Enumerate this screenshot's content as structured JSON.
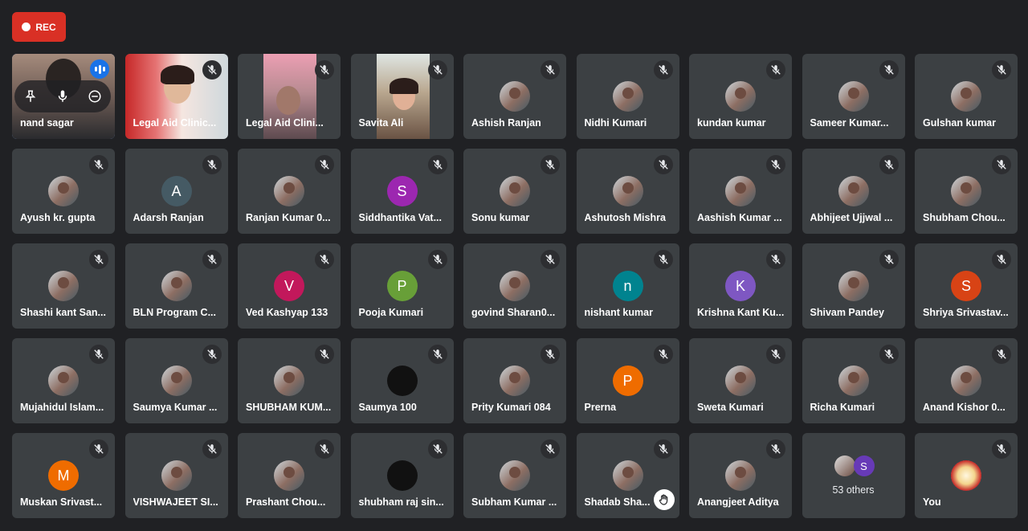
{
  "recording": {
    "label": "REC",
    "color": "#d93025"
  },
  "colors": {
    "tile": "#3c4043",
    "background": "#202124",
    "active_outline": "#8ab4f8"
  },
  "participants": [
    {
      "name": "nand sagar",
      "type": "video",
      "active_speaker": true
    },
    {
      "name": "Legal Aid Clinic...",
      "type": "video"
    },
    {
      "name": "Legal Aid Clini...",
      "type": "video"
    },
    {
      "name": "Savita Ali",
      "type": "video"
    },
    {
      "name": "Ashish Ranjan",
      "type": "photo"
    },
    {
      "name": "Nidhi Kumari",
      "type": "photo"
    },
    {
      "name": "kundan kumar",
      "type": "photo"
    },
    {
      "name": "Sameer Kumar...",
      "type": "photo"
    },
    {
      "name": "Gulshan kumar",
      "type": "photo"
    },
    {
      "name": "Ayush kr. gupta",
      "type": "photo"
    },
    {
      "name": "Adarsh Ranjan",
      "type": "initial",
      "initial": "A",
      "color": "#455a64"
    },
    {
      "name": "Ranjan Kumar 0...",
      "type": "photo"
    },
    {
      "name": "Siddhantika Vat...",
      "type": "initial",
      "initial": "S",
      "color": "#9c27b0"
    },
    {
      "name": "Sonu kumar",
      "type": "photo"
    },
    {
      "name": "Ashutosh Mishra",
      "type": "photo"
    },
    {
      "name": "Aashish Kumar ...",
      "type": "photo"
    },
    {
      "name": "Abhijeet Ujjwal ...",
      "type": "photo"
    },
    {
      "name": "Shubham Chou...",
      "type": "photo"
    },
    {
      "name": "Shashi kant San...",
      "type": "photo"
    },
    {
      "name": "BLN Program C...",
      "type": "photo"
    },
    {
      "name": "Ved Kashyap 133",
      "type": "initial",
      "initial": "V",
      "color": "#c2185b"
    },
    {
      "name": "Pooja Kumari",
      "type": "initial",
      "initial": "P",
      "color": "#689f38"
    },
    {
      "name": "govind Sharan0...",
      "type": "photo"
    },
    {
      "name": "nishant kumar",
      "type": "initial",
      "initial": "n",
      "color": "#00838f"
    },
    {
      "name": "Krishna Kant Ku...",
      "type": "initial",
      "initial": "K",
      "color": "#7e57c2"
    },
    {
      "name": "Shivam Pandey",
      "type": "photo"
    },
    {
      "name": "Shriya Srivastav...",
      "type": "initial",
      "initial": "S",
      "color": "#d84315"
    },
    {
      "name": "Mujahidul Islam...",
      "type": "photo"
    },
    {
      "name": "Saumya Kumar ...",
      "type": "photo"
    },
    {
      "name": "SHUBHAM KUM...",
      "type": "photo"
    },
    {
      "name": "Saumya 100",
      "type": "dark"
    },
    {
      "name": "Prity Kumari 084",
      "type": "photo"
    },
    {
      "name": "Prerna",
      "type": "initial",
      "initial": "P",
      "color": "#ef6c00"
    },
    {
      "name": "Sweta Kumari",
      "type": "photo"
    },
    {
      "name": "Richa Kumari",
      "type": "photo"
    },
    {
      "name": "Anand Kishor 0...",
      "type": "photo"
    },
    {
      "name": "Muskan Srivast...",
      "type": "initial",
      "initial": "M",
      "color": "#ef6c00"
    },
    {
      "name": "VISHWAJEET SI...",
      "type": "photo"
    },
    {
      "name": "Prashant Chou...",
      "type": "photo"
    },
    {
      "name": "shubham raj sin...",
      "type": "dark"
    },
    {
      "name": "Subham Kumar ...",
      "type": "photo"
    },
    {
      "name": "Shadab Sha...",
      "type": "photo",
      "hand_raised": true
    },
    {
      "name": "Anangjeet Aditya",
      "type": "photo"
    },
    {
      "name": "",
      "type": "others"
    },
    {
      "name": "You",
      "type": "you"
    }
  ],
  "others": {
    "label": "53 others",
    "initial": "S"
  }
}
